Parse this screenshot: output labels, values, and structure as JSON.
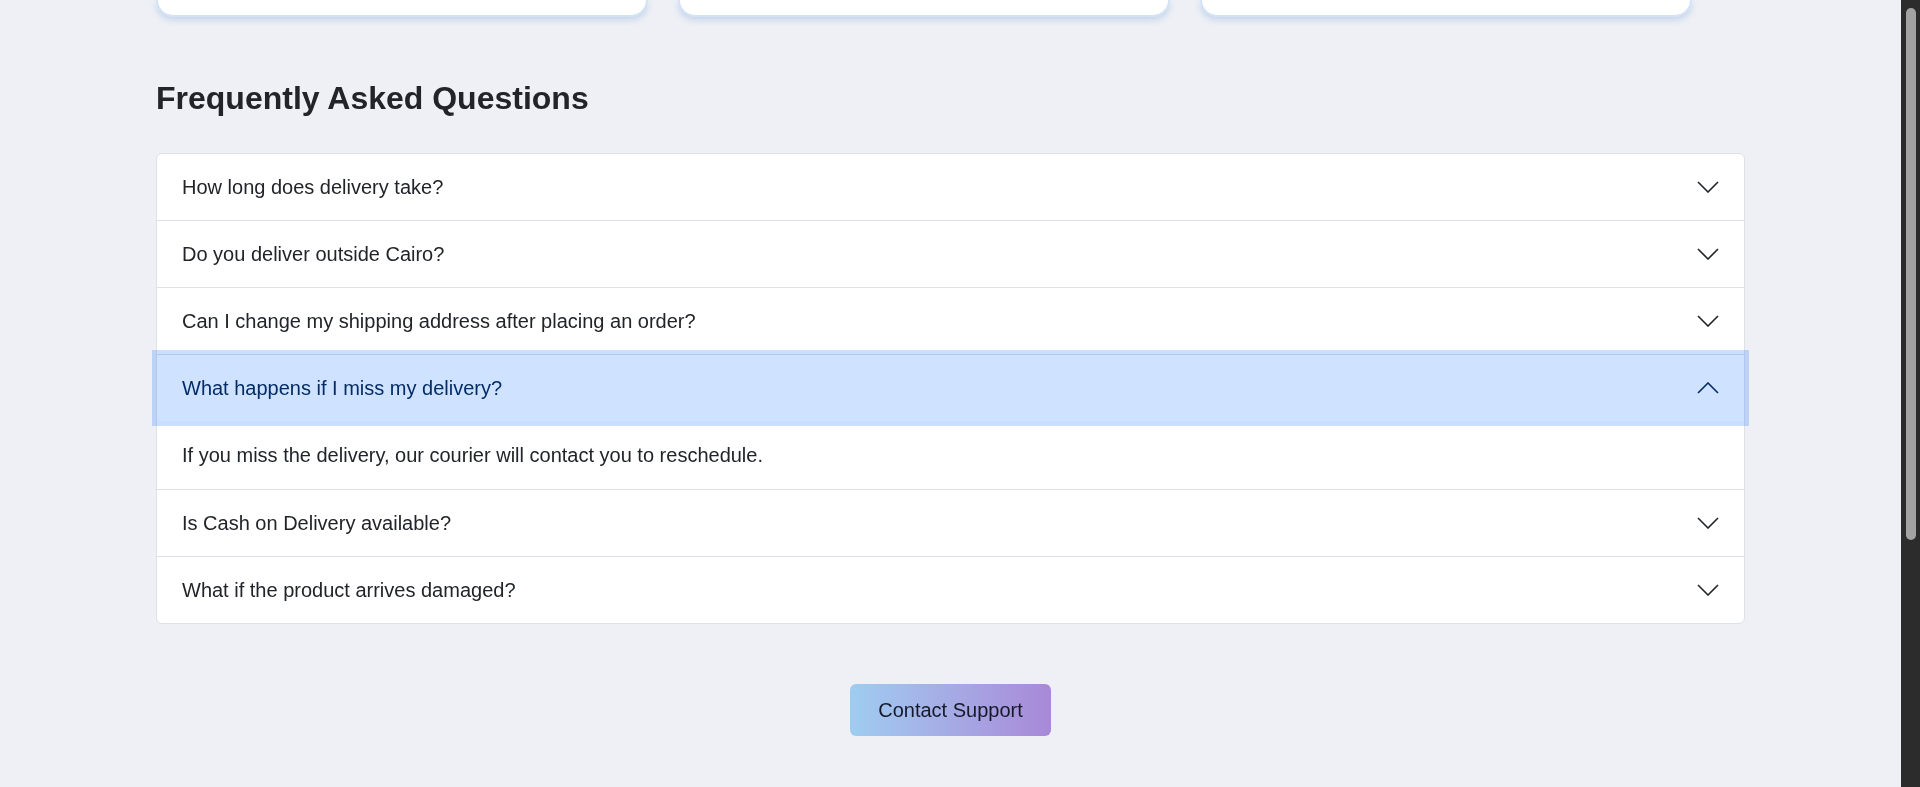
{
  "faq": {
    "title": "Frequently Asked Questions",
    "items": [
      {
        "question": "How long does delivery take?",
        "expanded": false
      },
      {
        "question": "Do you deliver outside Cairo?",
        "expanded": false
      },
      {
        "question": "Can I change my shipping address after placing an order?",
        "expanded": false
      },
      {
        "question": "What happens if I miss my delivery?",
        "expanded": true,
        "answer": "If you miss the delivery, our courier will contact you to reschedule."
      },
      {
        "question": "Is Cash on Delivery available?",
        "expanded": false
      },
      {
        "question": "What if the product arrives damaged?",
        "expanded": false
      }
    ]
  },
  "contact_button": {
    "label": "Contact Support"
  }
}
